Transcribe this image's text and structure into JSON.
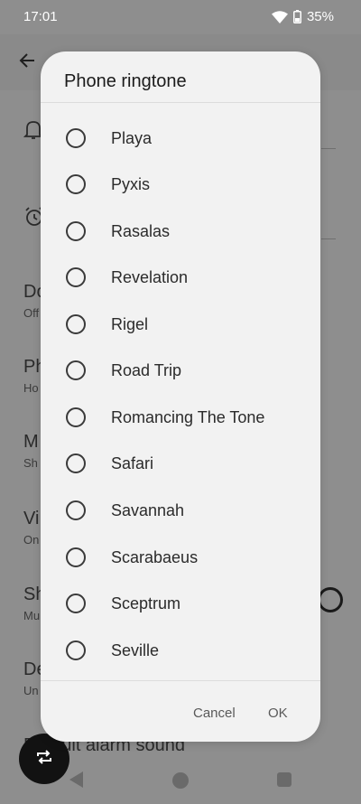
{
  "status_bar": {
    "time": "17:01",
    "battery": "35%"
  },
  "background": {
    "rows": [
      {
        "title": "Do",
        "subtitle": "Off"
      },
      {
        "title": "Ph",
        "subtitle": "Ho"
      },
      {
        "title": "M",
        "subtitle": "Sh"
      },
      {
        "title": "Vi",
        "subtitle": "On"
      },
      {
        "title": "Sh",
        "subtitle": "Mu"
      },
      {
        "title": "De",
        "subtitle": "Un"
      },
      {
        "title": "Default alarm sound",
        "subtitle": ""
      }
    ]
  },
  "dialog": {
    "title": "Phone ringtone",
    "options": [
      "Playa",
      "Pyxis",
      "Rasalas",
      "Revelation",
      "Rigel",
      "Road Trip",
      "Romancing The Tone",
      "Safari",
      "Savannah",
      "Scarabaeus",
      "Sceptrum",
      "Seville"
    ],
    "cancel_label": "Cancel",
    "ok_label": "OK"
  },
  "colors": {
    "scrim": "#8e8e8e",
    "dialog_bg": "#f2f2f2",
    "text": "#2b2b2b"
  }
}
